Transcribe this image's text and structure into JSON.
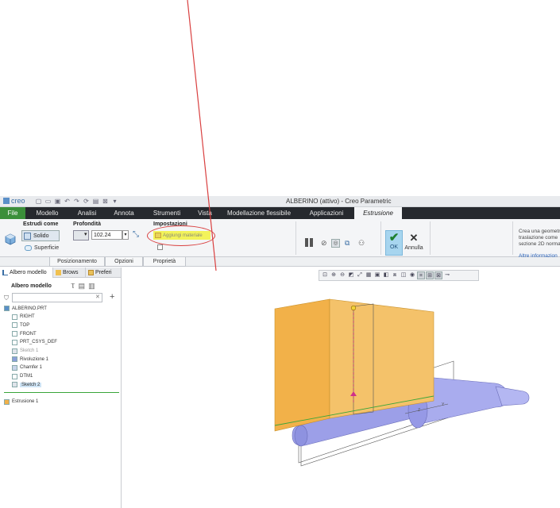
{
  "window": {
    "logo": "creo",
    "title": "ALBERINO (attivo) - Creo Parametric"
  },
  "tabs": [
    {
      "label": "File",
      "w": 32
    },
    {
      "label": "Modello",
      "w": 55
    },
    {
      "label": "Analisi",
      "w": 45
    },
    {
      "label": "Annota",
      "w": 48
    },
    {
      "label": "Strumenti",
      "w": 60
    },
    {
      "label": "Vista",
      "w": 36
    },
    {
      "label": "Modellazione flessibile",
      "w": 100
    },
    {
      "label": "Applicazioni",
      "w": 70
    },
    {
      "label": "Estrusione",
      "w": 60
    }
  ],
  "ribbon": {
    "group_estrudi": "Estrudi come",
    "solido": "Solido",
    "superficie": "Superficie",
    "group_profondita": "Profondità",
    "depth_value": "102.24",
    "group_impostazioni": "Impostazioni",
    "aggiungi_materiale": "Aggiungi materiale",
    "ok": "OK",
    "annulla": "Annulla",
    "help_text_1": "Crea una geometr",
    "help_text_2": "traslazione come",
    "help_text_3": "sezione 2D norma",
    "help_link": "Altre informazion"
  },
  "subtabs": [
    "Posizionamento",
    "Opzioni",
    "Proprietà"
  ],
  "leftpane": {
    "tab_model_tree": "Albero modello",
    "tab_browser": "Brows",
    "tab_favorites": "Preferi",
    "header": "Albero modello",
    "search_value": ""
  },
  "tree": [
    {
      "label": "ALBERINO.PRT",
      "icon": "part-icon",
      "state": "normal",
      "row": 0,
      "indent": 0
    },
    {
      "label": "RIGHT",
      "icon": "datum-plane-icon",
      "state": "normal",
      "row": 1,
      "indent": 1
    },
    {
      "label": "TOP",
      "icon": "datum-plane-icon",
      "state": "normal",
      "row": 2,
      "indent": 1
    },
    {
      "label": "FRONT",
      "icon": "datum-plane-icon",
      "state": "normal",
      "row": 3,
      "indent": 1
    },
    {
      "label": "PRT_CSYS_DEF",
      "icon": "csys-icon",
      "state": "normal",
      "row": 4,
      "indent": 1
    },
    {
      "label": "Sketch 1",
      "icon": "sketch-icon",
      "state": "dim",
      "row": 5,
      "indent": 1
    },
    {
      "label": "Rivoluzione 1",
      "icon": "revolve-icon",
      "state": "normal",
      "row": 6,
      "indent": 1
    },
    {
      "label": "Chamfer 1",
      "icon": "chamfer-icon",
      "state": "normal",
      "row": 7,
      "indent": 1
    },
    {
      "label": "DTM1",
      "icon": "datum-plane-icon",
      "state": "normal",
      "row": 8,
      "indent": 1
    },
    {
      "label": "Sketch 2",
      "icon": "sketch-icon",
      "state": "selected",
      "row": 9,
      "indent": 1
    },
    {
      "label": "Estrusione 1",
      "icon": "extrude-icon",
      "state": "normal",
      "row": 11,
      "indent": 0
    }
  ],
  "colors": {
    "file_tab": "#3b8f3a",
    "tab_bar": "#26292e",
    "highlight": "#f3f35a",
    "annotation": "#d94040",
    "extrusion": "#f2b149",
    "shaft": "#9c9fe8"
  }
}
